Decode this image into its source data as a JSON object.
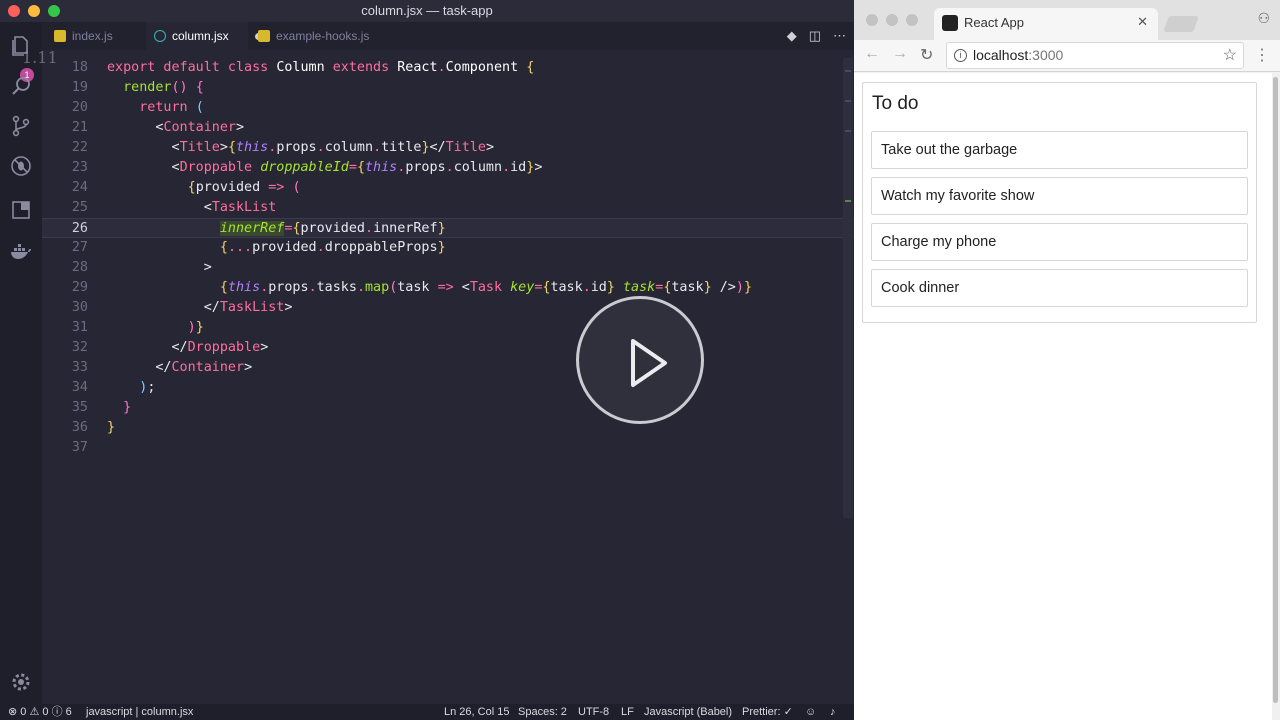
{
  "editor": {
    "window_title": "column.jsx — task-app",
    "ghost_text": "1.11",
    "badge_count": "1",
    "tabs": [
      {
        "label": "index.js",
        "type": "js",
        "active": false
      },
      {
        "label": "column.jsx",
        "type": "react",
        "active": true,
        "modified": true
      },
      {
        "label": "example-hooks.js",
        "type": "js",
        "active": false
      }
    ],
    "line_numbers": [
      "18",
      "19",
      "20",
      "21",
      "22",
      "23",
      "24",
      "25",
      "26",
      "27",
      "28",
      "29",
      "30",
      "31",
      "32",
      "33",
      "34",
      "35",
      "36",
      "37"
    ],
    "current_line": "26"
  },
  "status": {
    "errors": "0",
    "warnings": "0",
    "info": "6",
    "breadcrumb": "javascript | column.jsx",
    "position": "Ln 26, Col 15",
    "spaces": "Spaces: 2",
    "encoding": "UTF-8",
    "eol": "LF",
    "language": "Javascript (Babel)",
    "prettier": "Prettier: ✓"
  },
  "browser": {
    "tab_title": "React App",
    "url_host": "localhost",
    "url_port": ":3000"
  },
  "app": {
    "column_title": "To do",
    "tasks": [
      "Take out the garbage",
      "Watch my favorite show",
      "Charge my phone",
      "Cook dinner"
    ]
  },
  "colors": {
    "editor_bg": "#262634",
    "keyword": "#ff6e9e",
    "function": "#a6e22e",
    "this": "#ae81ff"
  }
}
